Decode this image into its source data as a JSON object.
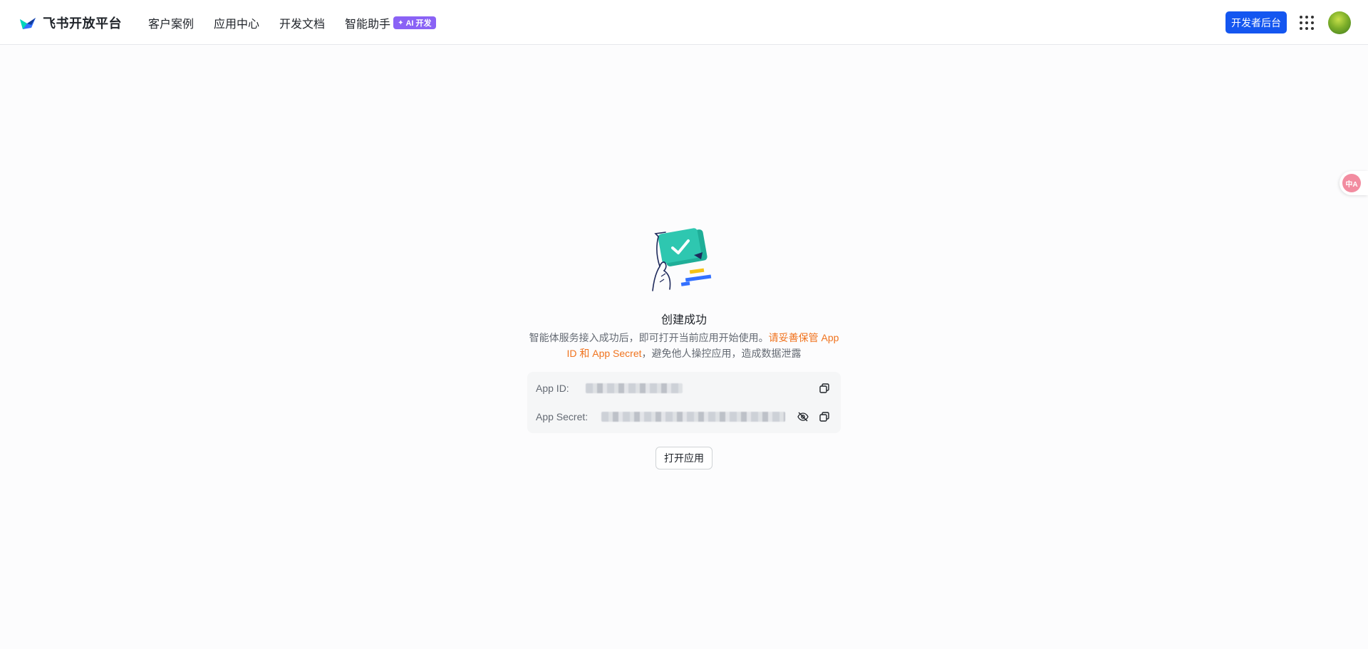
{
  "brand": {
    "name": "飞书开放平台",
    "logo_icon": "feishu-logo-icon"
  },
  "nav": {
    "items": [
      {
        "label": "客户案例"
      },
      {
        "label": "应用中心"
      },
      {
        "label": "开发文档"
      },
      {
        "label": "智能助手"
      }
    ],
    "ai_badge": "AI 开发"
  },
  "header_actions": {
    "dev_console_label": "开发者后台",
    "apps_icon": "apps-grid-icon",
    "avatar_icon": "avatar"
  },
  "translate_widget": {
    "label": "中A",
    "icon": "translate-icon"
  },
  "result": {
    "title": "创建成功",
    "desc_normal": "智能体服务接入成功后，即可打开当前应用开始使用。",
    "desc_warn": "请妥善保管 App ID 和 App Secret",
    "desc_tail": "，避免他人操控应用，造成数据泄露"
  },
  "credentials": {
    "app_id_label": "App ID:",
    "app_secret_label": "App Secret:",
    "copy_icon": "copy-icon",
    "eye_icon": "eye-off-icon"
  },
  "actions": {
    "open_app_label": "打开应用"
  },
  "colors": {
    "primary": "#1456f0",
    "warning": "#f0731e",
    "ai_badge": "#8a62f5",
    "illustration_teal": "#2ec7b0"
  }
}
